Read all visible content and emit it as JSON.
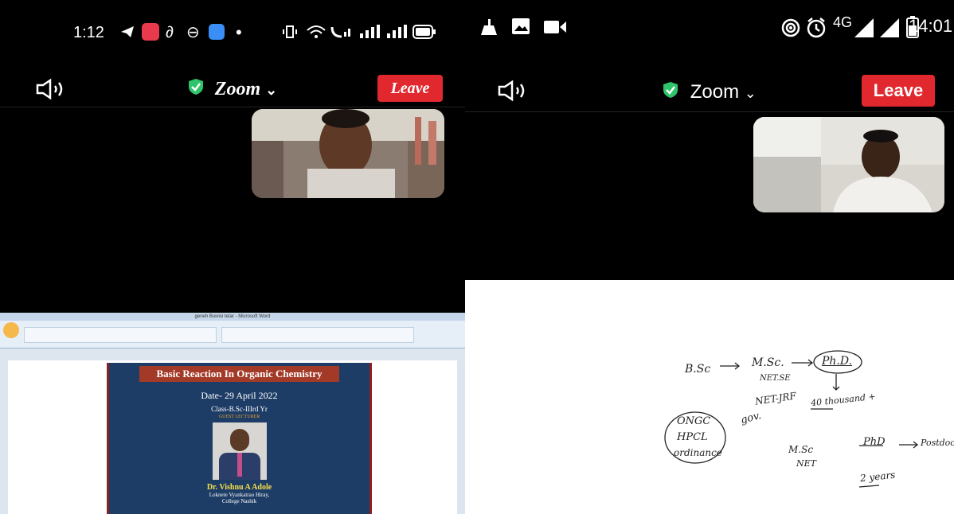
{
  "left": {
    "status": {
      "time": "1:12",
      "dot": "•"
    },
    "meeting": {
      "title": "Zoom",
      "chevron": "⌄",
      "leave_label": "Leave"
    },
    "slide": {
      "window_title": "geneh Buivisi tetar - Microsoft Word",
      "heading": "Basic Reaction In Organic Chemistry",
      "date": "Date- 29 April 2022",
      "class": "Class-B.Sc-IIIrd Yr",
      "guest_tag": "GUEST LECTURER",
      "presenter": "Dr. Vishnu A Adole",
      "college_line1": "Loknete Vyankatrao Hiray,",
      "college_line2": "College Nashik"
    }
  },
  "right": {
    "status": {
      "network": "4G",
      "time": "14:01"
    },
    "meeting": {
      "title": "Zoom",
      "chevron": "⌄",
      "leave_label": "Leave"
    },
    "whiteboard": {
      "n1": "B.Sc",
      "n2": "M.Sc.",
      "n3": "Ph.D.",
      "n4": "NET.SE",
      "n5": "NET-JRF",
      "n6": "40 thousand +",
      "n7": "gov.",
      "n8": "ONGC",
      "n9": "HPCL",
      "n10": "ordinance",
      "n11": "M.Sc",
      "n12": "NET",
      "n13": "PhD",
      "n14": "Postdoc",
      "n15": "2 years"
    }
  },
  "colors": {
    "leave": "#e0282e",
    "shield": "#2fc46b",
    "background": "#000000",
    "whiteboard": "#ffffff"
  }
}
